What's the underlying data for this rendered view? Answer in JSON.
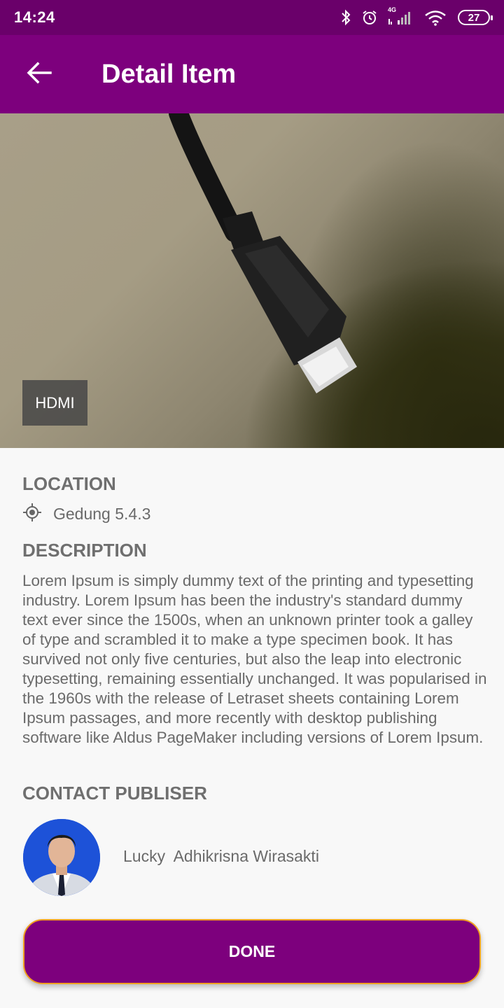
{
  "status_bar": {
    "time": "14:24",
    "network_label": "4G",
    "battery_level": "27",
    "icons": [
      "bluetooth-icon",
      "alarm-icon",
      "signal-icon",
      "wifi-icon",
      "battery-icon"
    ]
  },
  "app_bar": {
    "title": "Detail Item",
    "back_icon": "arrow-left-icon",
    "color": "#7d007d"
  },
  "hero": {
    "image_label": "HDMI"
  },
  "location": {
    "heading": "LOCATION",
    "icon": "gps-target-icon",
    "value": "Gedung 5.4.3"
  },
  "description": {
    "heading": "DESCRIPTION",
    "body": "Lorem Ipsum is simply dummy text of the printing and typesetting industry. Lorem Ipsum has been the industry's standard dummy text ever since the 1500s, when an unknown printer took a galley of type and scrambled it to make a type specimen book. It has survived not only five centuries, but also the leap into electronic typesetting, remaining essentially unchanged. It was popularised in the 1960s with the release of Letraset sheets containing Lorem Ipsum passages, and more recently with desktop publishing software like Aldus PageMaker including versions of Lorem Ipsum."
  },
  "contact": {
    "heading": "CONTACT PUBLISER",
    "name": "Lucky  Adhikrisna Wirasakti"
  },
  "actions": {
    "done_label": "DONE",
    "done_border_color": "#f0a020"
  }
}
